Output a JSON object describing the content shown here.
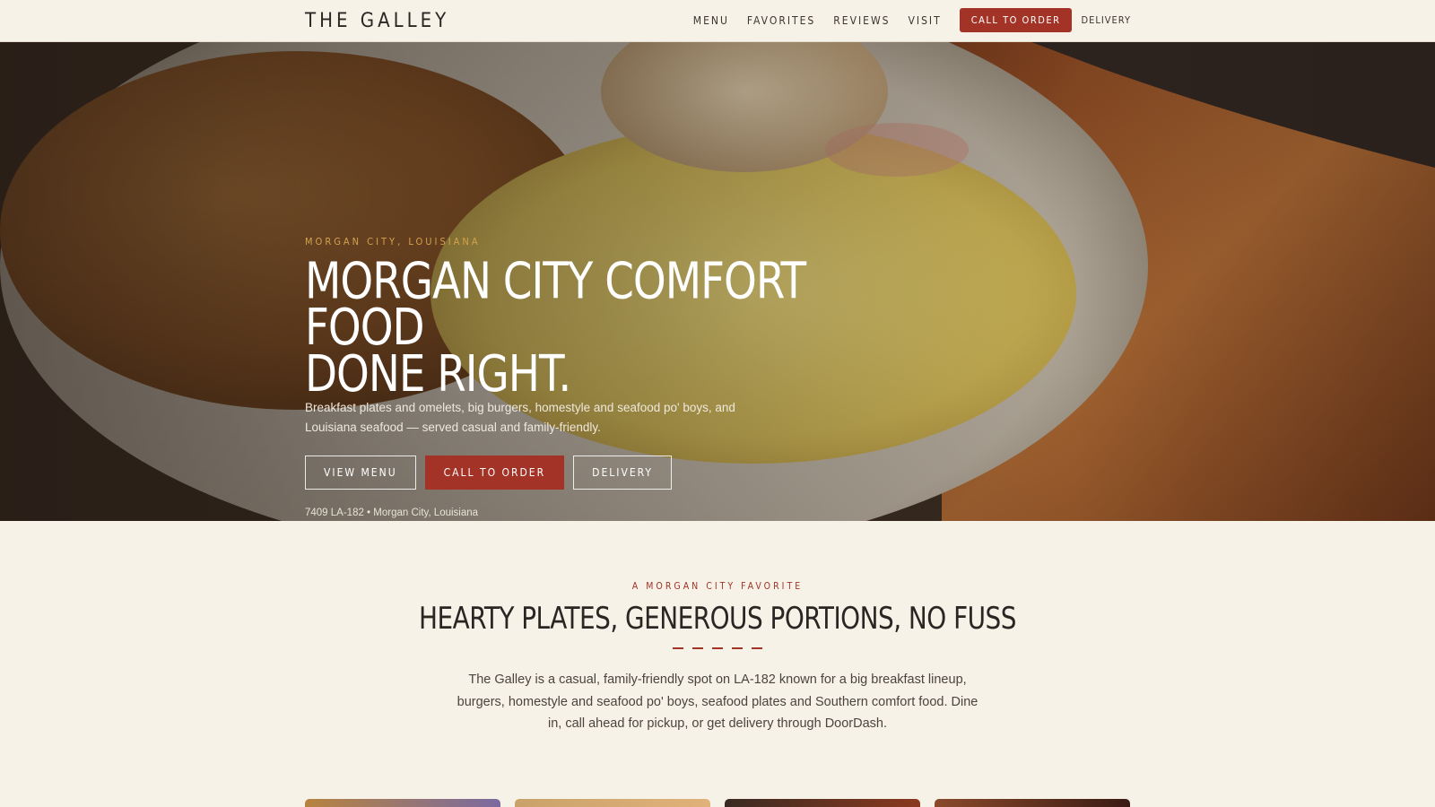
{
  "brand": "THE GALLEY",
  "nav": {
    "links": [
      "MENU",
      "FAVORITES",
      "REVIEWS",
      "VISIT"
    ],
    "cta": "CALL TO ORDER",
    "delivery": "DELIVERY"
  },
  "hero": {
    "eyebrow": "MORGAN CITY, LOUISIANA",
    "title_line1": "MORGAN CITY COMFORT FOOD",
    "title_line2": "DONE RIGHT.",
    "subtitle": "Breakfast plates and omelets, big burgers, homestyle and seafood po' boys, and Louisiana seafood — served casual and family-friendly.",
    "buttons": {
      "menu": "VIEW MENU",
      "call": "CALL TO ORDER",
      "delivery": "DELIVERY"
    },
    "address": "7409 LA-182 • Morgan City, Louisiana"
  },
  "intro": {
    "eyebrow": "A MORGAN CITY FAVORITE",
    "title": "HEARTY PLATES, GENEROUS PORTIONS, NO FUSS",
    "text": "The Galley is a casual, family-friendly spot on LA-182 known for a big breakfast lineup, burgers, homestyle and seafood po' boys, seafood plates and Southern comfort food. Dine in, call ahead for pickup, or get delivery through DoorDash."
  },
  "colors": {
    "accent": "#a33327",
    "gold": "#d4a24c",
    "background": "#f7f2e8"
  }
}
